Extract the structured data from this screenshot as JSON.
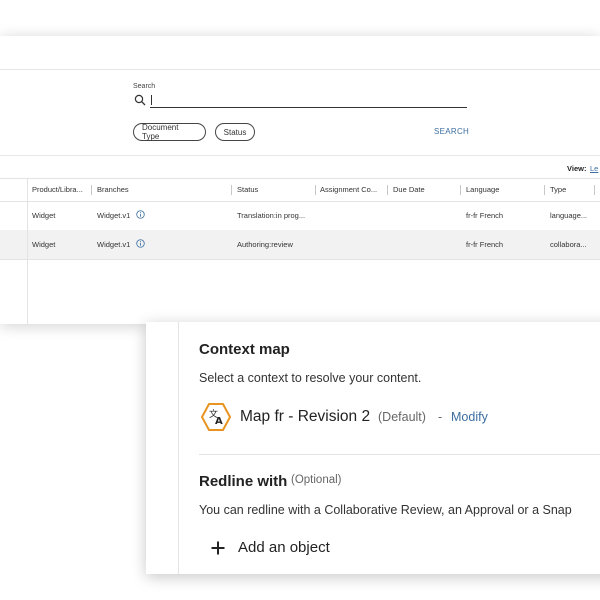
{
  "search": {
    "label": "Search",
    "value": ""
  },
  "filters": [
    {
      "label": "Document Type"
    },
    {
      "label": "Status"
    }
  ],
  "search_button": "SEARCH",
  "view": {
    "label": "View:",
    "value": "Le"
  },
  "table": {
    "headers": [
      "Product/Libra...",
      "Branches",
      "Status",
      "Assignment Co...",
      "Due Date",
      "Language",
      "Type"
    ],
    "rows": [
      {
        "product": "Widget",
        "branch": "Widget.v1",
        "status": "Translation:in prog...",
        "assignment": "",
        "due": "",
        "language": "fr-fr French",
        "type": "language..."
      },
      {
        "product": "Widget",
        "branch": "Widget.v1",
        "status": "Authoring:review",
        "assignment": "",
        "due": "",
        "language": "fr-fr French",
        "type": "collabora..."
      }
    ]
  },
  "context_map": {
    "title": "Context map",
    "description": "Select a context to resolve your content.",
    "map_icon": "translate-icon",
    "map_name": "Map fr - Revision 2",
    "map_default": "(Default)",
    "separator": "-",
    "modify_label": "Modify"
  },
  "redline": {
    "title": "Redline with",
    "optional": "(Optional)",
    "description": "You can redline with a Collaborative Review, an Approval or a Snap",
    "add_label": "Add an object",
    "add_icon": "plus-icon"
  },
  "colors": {
    "link": "#3c6ea0",
    "accent_orange": "#e8941f",
    "row_alt": "#f2f2f2"
  }
}
